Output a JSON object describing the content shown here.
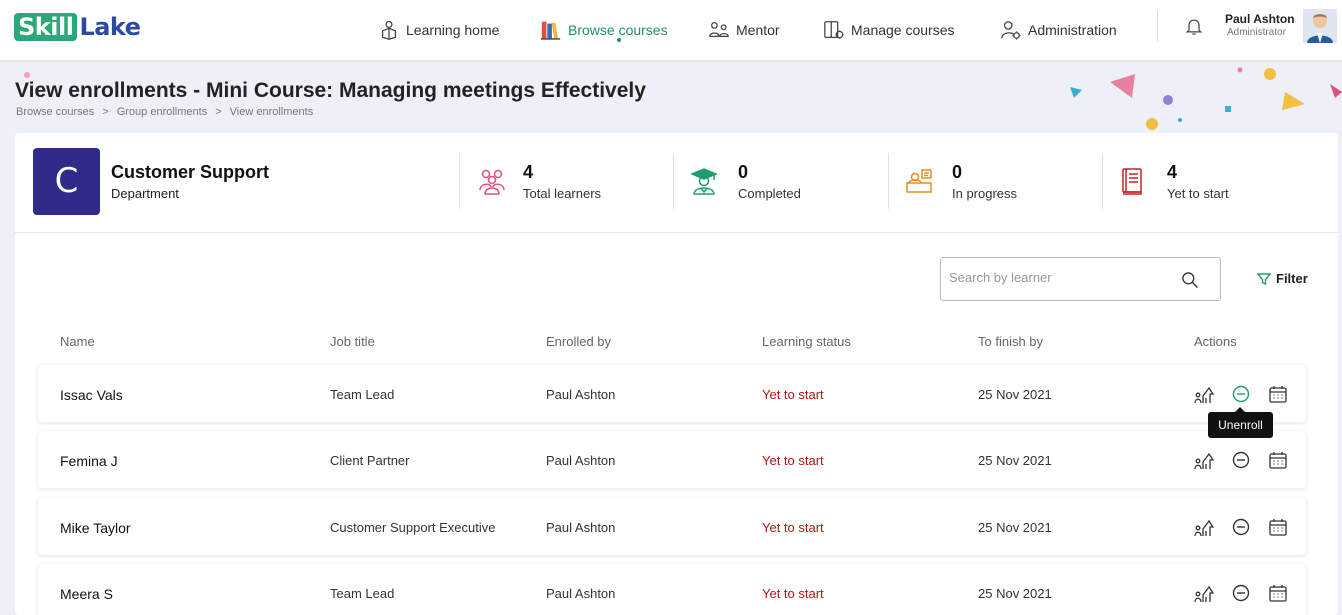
{
  "brand": {
    "part1": "Skill",
    "part2": "Lake"
  },
  "nav": [
    {
      "label": "Learning home",
      "icon": "learning-home-icon"
    },
    {
      "label": "Browse courses",
      "icon": "books-icon",
      "active": true
    },
    {
      "label": "Mentor",
      "icon": "mentor-icon"
    },
    {
      "label": "Manage courses",
      "icon": "manage-courses-icon"
    },
    {
      "label": "Administration",
      "icon": "administration-icon"
    }
  ],
  "user": {
    "name": "Paul Ashton",
    "role": "Administrator"
  },
  "page": {
    "title": "View enrollments - Mini Course: Managing meetings Effectively",
    "breadcrumb": [
      "Browse courses",
      ">",
      "Group enrollments",
      ">",
      "View enrollments"
    ]
  },
  "group": {
    "initial": "C",
    "name": "Customer Support",
    "type": "Department",
    "color": "#302a8a"
  },
  "stats": [
    {
      "value": "4",
      "label": "Total learners",
      "icon": "learners-icon",
      "color": "#e0507a"
    },
    {
      "value": "0",
      "label": "Completed",
      "icon": "graduate-icon",
      "color": "#1f9d6a"
    },
    {
      "value": "0",
      "label": "In progress",
      "icon": "in-progress-icon",
      "color": "#e88a2a"
    },
    {
      "value": "4",
      "label": "Yet to start",
      "icon": "book-icon",
      "color": "#c8202a"
    }
  ],
  "search": {
    "placeholder": "Search by learner"
  },
  "filter_label": "Filter",
  "table": {
    "headers": [
      "Name",
      "Job title",
      "Enrolled by",
      "Learning status",
      "To finish by",
      "Actions"
    ],
    "rows": [
      {
        "name": "Issac Vals",
        "job": "Team Lead",
        "enrolled_by": "Paul Ashton",
        "status": "Yet to start",
        "finish_by": "25 Nov 2021"
      },
      {
        "name": "Femina J",
        "job": "Client Partner",
        "enrolled_by": "Paul Ashton",
        "status": "Yet to start",
        "finish_by": "25 Nov 2021"
      },
      {
        "name": "Mike Taylor",
        "job": "Customer Support Executive",
        "enrolled_by": "Paul Ashton",
        "status": "Yet to start",
        "finish_by": "25 Nov 2021"
      },
      {
        "name": "Meera S",
        "job": "Team Lead",
        "enrolled_by": "Paul Ashton",
        "status": "Yet to start",
        "finish_by": "25 Nov 2021"
      }
    ]
  },
  "tooltip": "Unenroll",
  "colors": {
    "accent": "#1f8f72",
    "status_red": "#b31414"
  }
}
